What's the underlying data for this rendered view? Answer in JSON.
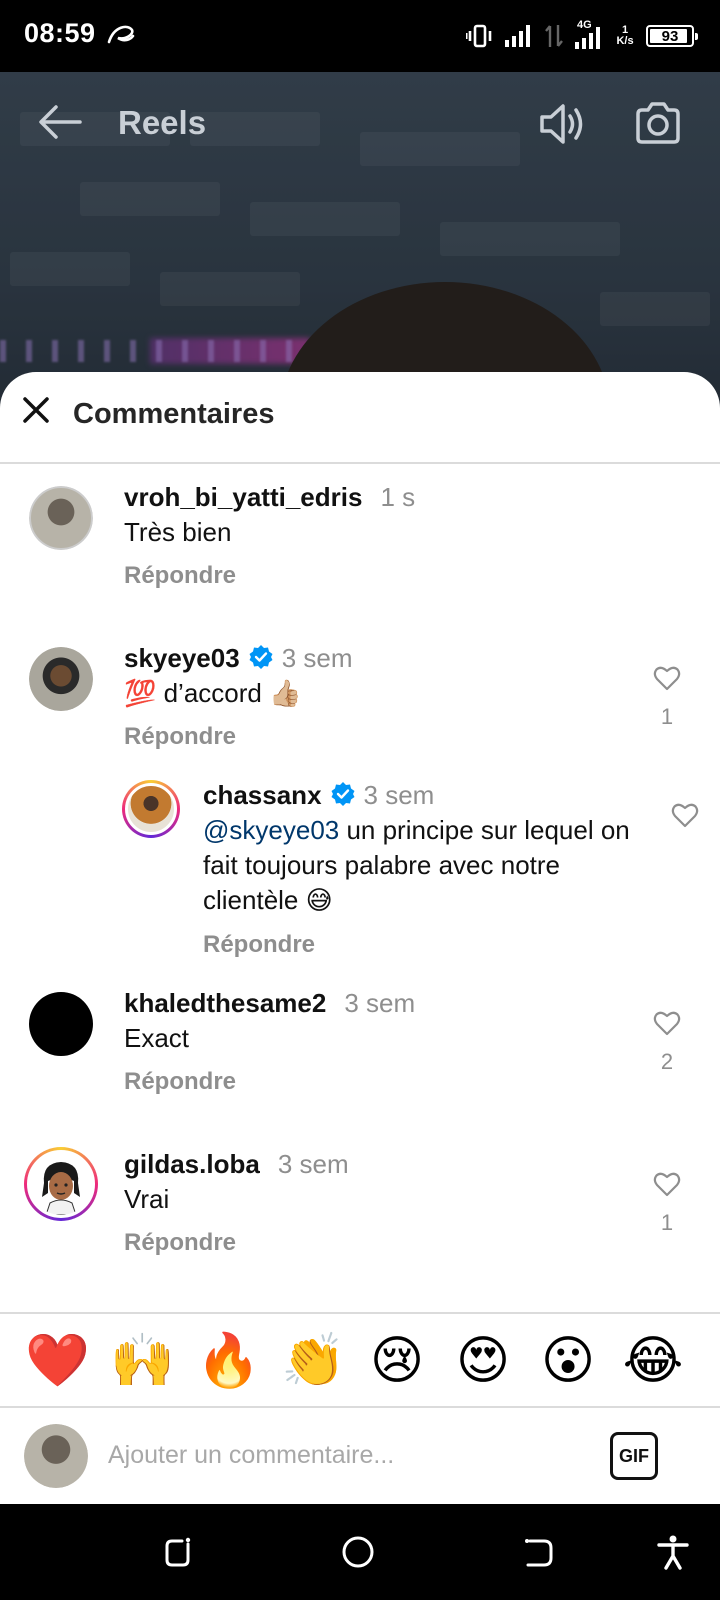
{
  "status_bar": {
    "time": "08:59",
    "network_type": "4G",
    "net_speed_value": "1",
    "net_speed_unit": "K/s",
    "battery": "93",
    "battery_percent": 93
  },
  "header": {
    "back_icon": "arrow-left-icon",
    "title": "Reels",
    "sound_icon": "speaker-icon",
    "camera_icon": "camera-icon"
  },
  "sheet": {
    "title": "Commentaires",
    "close_icon": "close-icon"
  },
  "comments": [
    {
      "username": "vroh_bi_yatti_edris",
      "time": "1 s",
      "text": "Très bien",
      "reply_label": "Répondre",
      "likes": ""
    },
    {
      "username": "skyeye03",
      "verified": true,
      "time": "3 sem",
      "text": "💯 d’accord 👍🏼",
      "reply_label": "Répondre",
      "likes": "1"
    },
    {
      "username": "chassanx",
      "verified": true,
      "time": "3 sem",
      "mention": "@skyeye03",
      "text": " un principe sur lequel on fait toujours palabre avec notre clientèle 😅",
      "reply_label": "Répondre",
      "likes": ""
    },
    {
      "username": "khaledthesame2",
      "time": "3 sem",
      "text": "Exact",
      "reply_label": "Répondre",
      "likes": "2"
    },
    {
      "username": "gildas.loba",
      "time": "3 sem",
      "text": "Vrai",
      "reply_label": "Répondre",
      "likes": "1"
    }
  ],
  "emojis": [
    "❤️",
    "🙌",
    "🔥",
    "👏",
    "😢",
    "😍",
    "😮",
    "😂"
  ],
  "composer": {
    "placeholder": "Ajouter un commentaire...",
    "gif_label": "GIF"
  },
  "colors": {
    "verified": "#0095f6",
    "secondary_text": "#8e8e8e",
    "mention": "#00376b"
  }
}
